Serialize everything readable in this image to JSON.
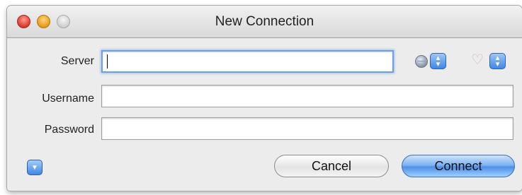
{
  "window": {
    "title": "New Connection"
  },
  "form": {
    "server": {
      "label": "Server",
      "value": ""
    },
    "username": {
      "label": "Username",
      "value": ""
    },
    "password": {
      "label": "Password",
      "value": ""
    }
  },
  "buttons": {
    "cancel": "Cancel",
    "connect": "Connect"
  },
  "icons": {
    "protocol": "globe-icon",
    "bookmark": "heart-icon",
    "popup": "up-down-arrows-icon",
    "disclosure": "chevron-down-icon"
  },
  "colors": {
    "accent": "#4d90e8",
    "close": "#d9392b",
    "minimize": "#e59a17"
  }
}
